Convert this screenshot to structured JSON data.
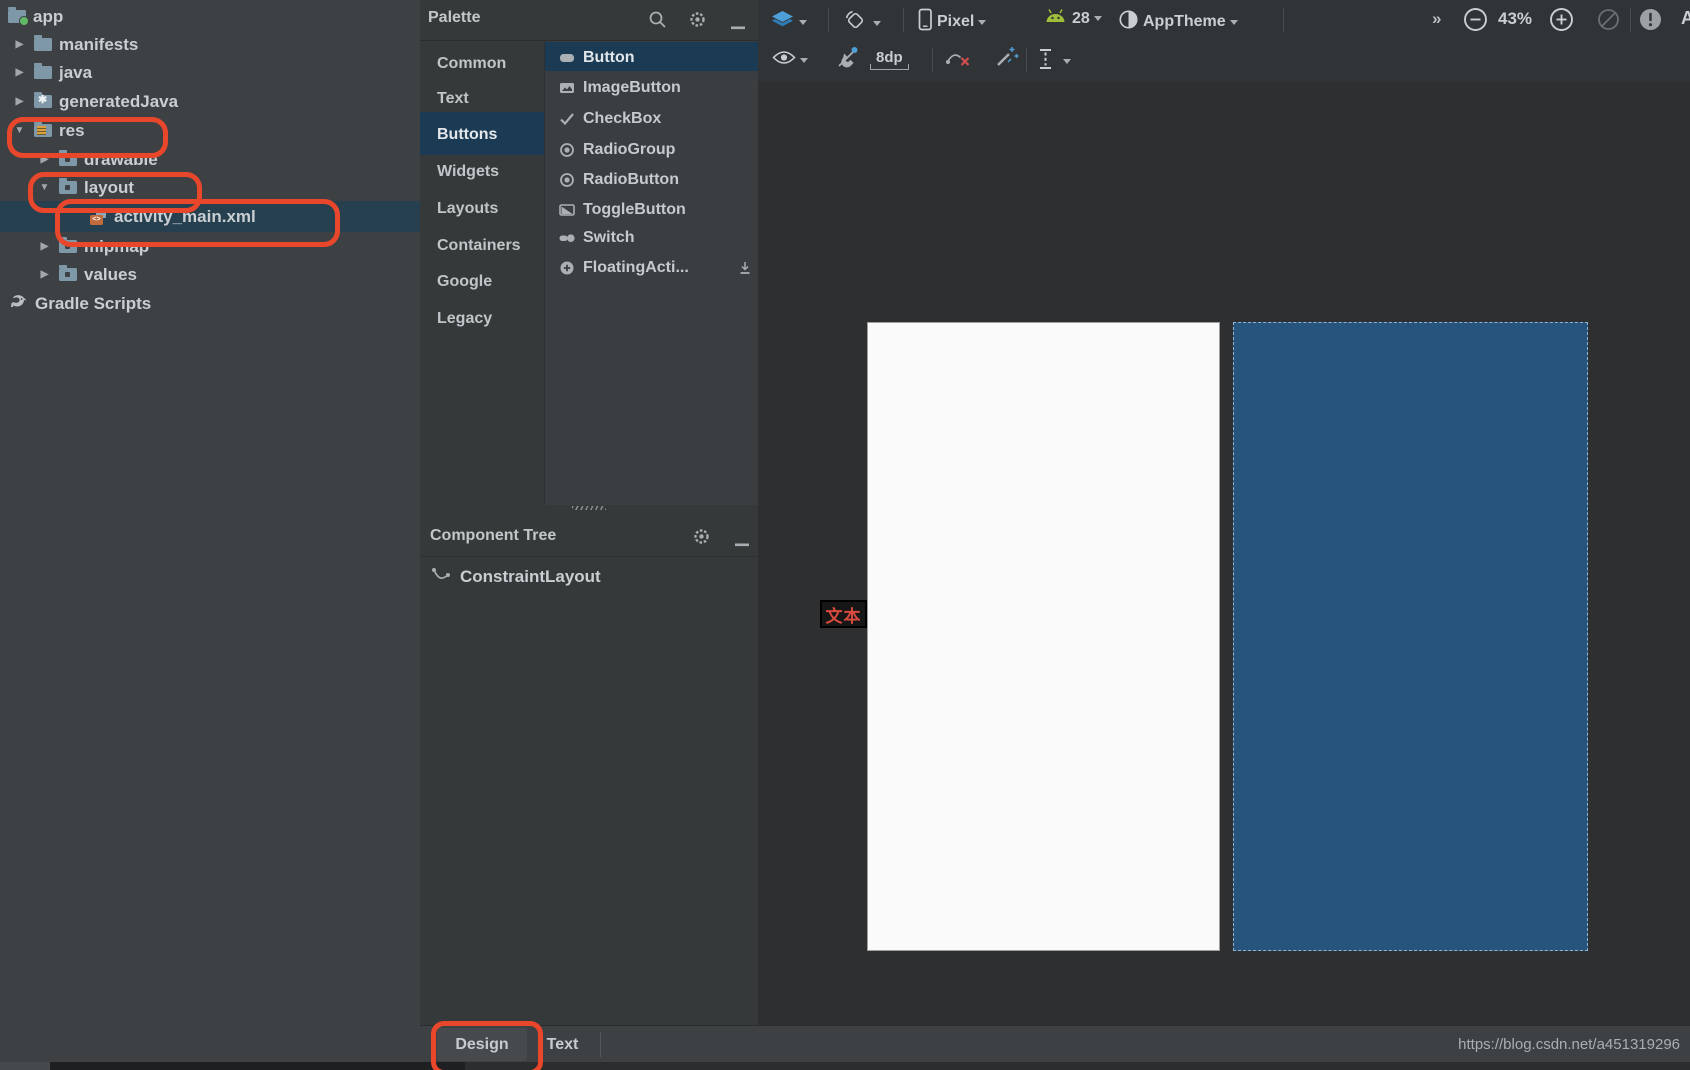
{
  "project_tree": {
    "items": [
      {
        "label": "app"
      },
      {
        "label": "manifests"
      },
      {
        "label": "java"
      },
      {
        "label": "generatedJava"
      },
      {
        "label": "res",
        "expanded": true,
        "annotated": true
      },
      {
        "label": "drawable"
      },
      {
        "label": "layout",
        "expanded": true,
        "annotated": true
      },
      {
        "label": "activity_main.xml",
        "selected": true,
        "annotated": true
      },
      {
        "label": "mipmap"
      },
      {
        "label": "values"
      },
      {
        "label": "Gradle Scripts"
      }
    ]
  },
  "palette": {
    "title": "Palette",
    "categories": [
      {
        "label": "Common"
      },
      {
        "label": "Text"
      },
      {
        "label": "Buttons",
        "selected": true
      },
      {
        "label": "Widgets"
      },
      {
        "label": "Layouts"
      },
      {
        "label": "Containers"
      },
      {
        "label": "Google"
      },
      {
        "label": "Legacy"
      }
    ],
    "items": [
      {
        "label": "Button",
        "selected": true
      },
      {
        "label": "ImageButton"
      },
      {
        "label": "CheckBox"
      },
      {
        "label": "RadioGroup"
      },
      {
        "label": "RadioButton"
      },
      {
        "label": "ToggleButton"
      },
      {
        "label": "Switch"
      },
      {
        "label": "FloatingActi...",
        "downloadable": true
      }
    ]
  },
  "component_tree": {
    "title": "Component Tree",
    "items": [
      {
        "label": "ConstraintLayout"
      }
    ]
  },
  "design_toolbar": {
    "device": "Pixel",
    "api_level": "28",
    "theme": "AppTheme",
    "chevrons": "»",
    "zoom_level": "43%",
    "default_margin": "8dp",
    "overflow_letter": "A"
  },
  "canvas": {
    "selection_label": "文本",
    "blueprint_color": "#26547C",
    "design_background": "#FAFAFA"
  },
  "editor_tabs": {
    "design": "Design",
    "text": "Text"
  },
  "footer": {
    "watermark": "https://blog.csdn.net/a451319296"
  },
  "annotation_color": "#E9472B"
}
